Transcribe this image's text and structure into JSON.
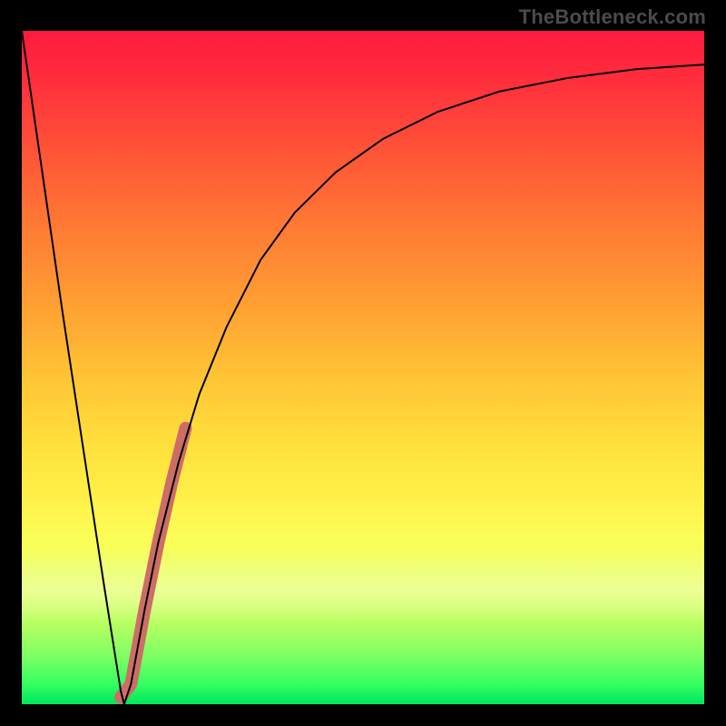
{
  "watermark": "TheBottleneck.com",
  "chart_data": {
    "type": "line",
    "title": "",
    "xlabel": "",
    "ylabel": "",
    "xlim": [
      0,
      100
    ],
    "ylim": [
      0,
      100
    ],
    "grid": false,
    "series": [
      {
        "name": "bottleneck-curve",
        "color": "#000000",
        "stroke_width": 2,
        "x": [
          0,
          3,
          6,
          9,
          12,
          14.5,
          15,
          16,
          18,
          20,
          23,
          26,
          30,
          35,
          40,
          46,
          53,
          61,
          70,
          80,
          90,
          100
        ],
        "y": [
          100,
          79,
          58,
          38,
          18,
          2,
          0,
          3,
          14,
          24,
          36,
          46,
          56,
          66,
          73,
          79,
          84,
          88,
          91,
          93,
          94.3,
          95
        ]
      },
      {
        "name": "highlight-segment",
        "color": "#cc6e66",
        "stroke_width": 14,
        "linecap": "round",
        "x": [
          14.5,
          16,
          18,
          20,
          22,
          24
        ],
        "y": [
          1,
          3,
          14,
          24,
          33,
          41
        ]
      }
    ],
    "background": {
      "type": "vertical-gradient",
      "stops": [
        {
          "pos": 0.0,
          "color": "#ff1a3f"
        },
        {
          "pos": 0.3,
          "color": "#ff7d34"
        },
        {
          "pos": 0.62,
          "color": "#ffe13d"
        },
        {
          "pos": 0.88,
          "color": "#b8ff63"
        },
        {
          "pos": 1.0,
          "color": "#00e65a"
        }
      ]
    }
  }
}
